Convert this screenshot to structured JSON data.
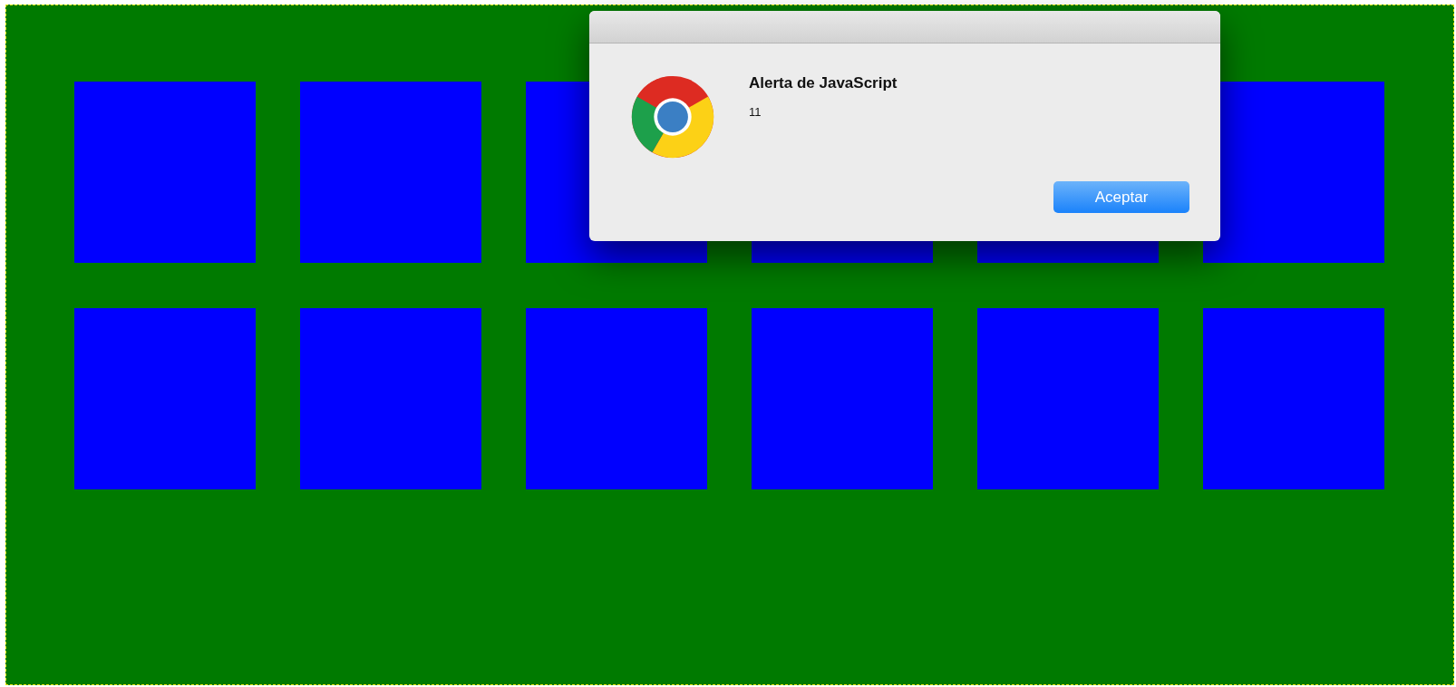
{
  "dialog": {
    "title": "Alerta de JavaScript",
    "message": "11",
    "buttons": [
      "Aceptar"
    ]
  }
}
